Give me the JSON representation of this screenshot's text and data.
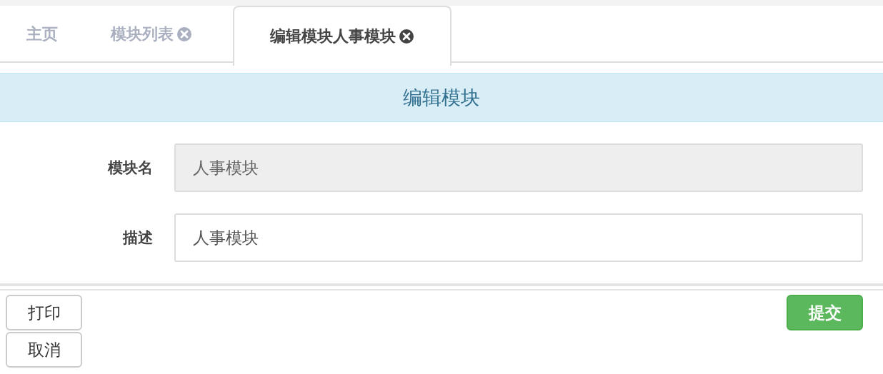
{
  "tabs": [
    {
      "label": "主页",
      "selected": false,
      "closable": false
    },
    {
      "label": "模块列表",
      "selected": false,
      "closable": true
    },
    {
      "label": "编辑模块人事模块",
      "selected": true,
      "closable": true
    }
  ],
  "panel": {
    "title": "编辑模块"
  },
  "form": {
    "fields": [
      {
        "label": "模块名",
        "value": "人事模块",
        "disabled": true
      },
      {
        "label": "描述",
        "value": "人事模块",
        "disabled": false
      }
    ]
  },
  "buttons": {
    "left": [
      {
        "label": "打印"
      },
      {
        "label": "取消"
      }
    ],
    "right": [
      {
        "label": "提交",
        "kind": "primary"
      }
    ]
  }
}
